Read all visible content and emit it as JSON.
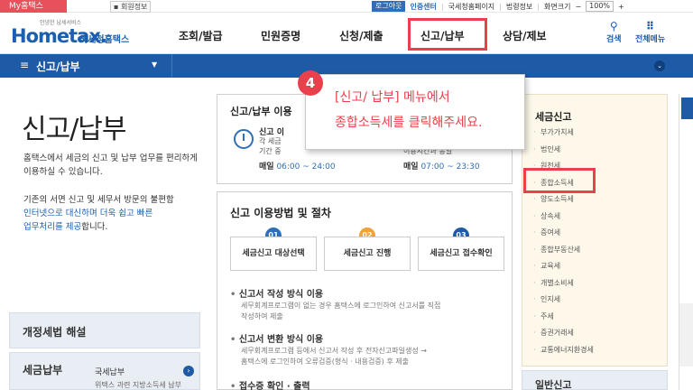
{
  "topbar": {
    "my_hometax": "My홈택스",
    "member_info": "회원정보",
    "logout": "로그아웃",
    "cert_center": "인증센터",
    "nts_site": "국세청홈페이지",
    "law_info": "법령정보",
    "zoom_label": "화면크기",
    "zoom_value": "100%"
  },
  "header": {
    "logo_main": "Hometax.",
    "logo_sub": "국세청홈택스",
    "logo_tag": "안녕한 납세서비스",
    "gnb": [
      "조회/발급",
      "민원증명",
      "신청/제출",
      "신고/납부",
      "상담/제보"
    ],
    "search": "검색",
    "all_menu": "전체메뉴"
  },
  "bluebar": {
    "current": "신고/납부"
  },
  "left": {
    "title": "신고/납부",
    "intro": "홈택스에서 세금의 신고 및 납부 업무를 편리하게 이용하실 수 있습니다.",
    "intro2_a": "기존의 서면 신고 및 세무서 방문의 불편함",
    "intro2_b": "인터넷으로 대신하며 더욱 쉽고 빠른",
    "intro2_c": "업무처리를 제공",
    "intro2_d": "합니다.",
    "box1": "개정세법 해설",
    "box2_title": "세금납부",
    "box2_sub": "국세납부",
    "box2_sub2": "위택스 과련 지방소득세 납부"
  },
  "card1": {
    "title": "신고/납부 이용",
    "l1": "신고 이",
    "l2": "각 세금",
    "l3": "기간 중",
    "l4_label": "매일",
    "l4_time": "06:00 ~ 24:00",
    "r3": "이용시간과 동일",
    "r4_label": "매일",
    "r4_time": "07:00 ~ 23:30"
  },
  "card2": {
    "title": "신고 이용방법 및 절차",
    "steps": [
      {
        "no": "01",
        "label": "세금신고 대상선택"
      },
      {
        "no": "02",
        "label": "세금신고 진행"
      },
      {
        "no": "03",
        "label": "세금신고 접수확인"
      }
    ],
    "m1": "신고서 작성 방식 이용",
    "m1_desc_a": "세무회계프로그램이 없는 경우 홈택스에 로그인하여 신고서를 직접",
    "m1_desc_b": "작성하여 제출",
    "m2": "신고서 변환 방식 이용",
    "m2_desc_a": "세무회계프로그램 등에서 신고서 작성 후 전자신고파일생성 →",
    "m2_desc_b": "홈택스에 로그인하여 오류검증(형식 · 내용검증) 후 제출",
    "m3": "접수증 확인 · 출력"
  },
  "side": {
    "title": "세금신고",
    "items": [
      "부가가치세",
      "법인세",
      "원천세",
      "종합소득세",
      "양도소득세",
      "상속세",
      "증여세",
      "종합부동산세",
      "교육세",
      "개별소비세",
      "인지세",
      "주세",
      "증권거래세",
      "교통에너지환경세"
    ],
    "box2": "일반신고"
  },
  "tooltip": {
    "step": "4",
    "line1": "[신고/ 납부] 메뉴에서",
    "line2": "종합소득세를 클릭해주세요."
  },
  "colors": {
    "brand_blue": "#1e5aa5",
    "highlight_red": "#e8414b",
    "step1": "#2e6fb7",
    "step2": "#f0a23a",
    "step3": "#1e5aa5"
  }
}
